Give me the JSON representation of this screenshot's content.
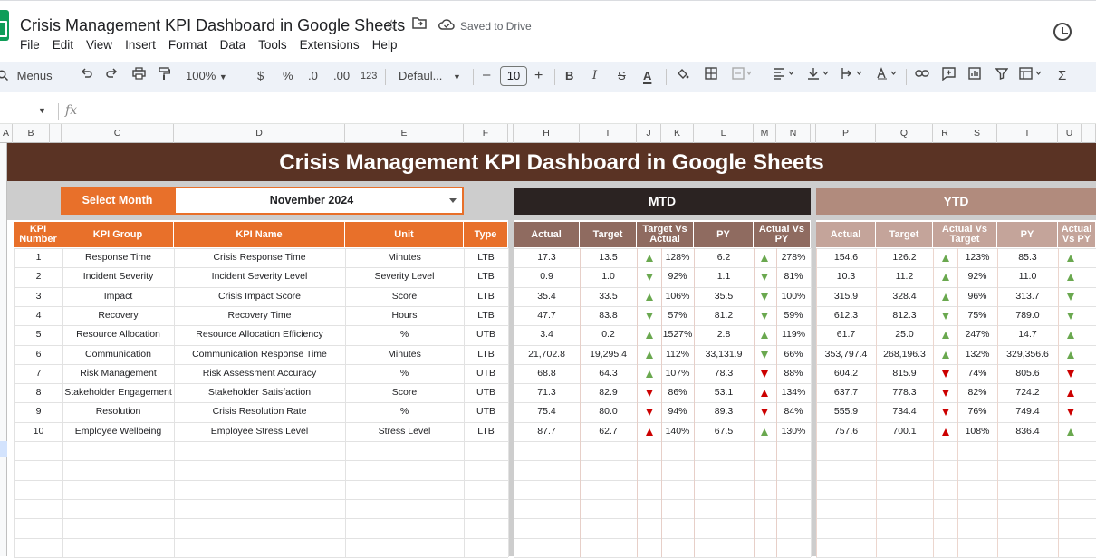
{
  "app": {
    "doc_title": "Crisis Management KPI Dashboard in Google Sheets",
    "saved_status": "Saved to Drive",
    "menu": [
      "File",
      "Edit",
      "View",
      "Insert",
      "Format",
      "Data",
      "Tools",
      "Extensions",
      "Help"
    ]
  },
  "toolbar": {
    "menus_label": "Menus",
    "zoom": "100%",
    "currency": "$",
    "percent": "%",
    "dec_decrease": ".0",
    "dec_increase": ".00",
    "number_format": "123",
    "font": "Defaul...",
    "minus": "–",
    "font_size": "10",
    "plus": "+",
    "bold": "B",
    "italic": "I",
    "strike": "S",
    "text_color": "A",
    "sigma": "Σ"
  },
  "formula_bar": {
    "fx": "fx"
  },
  "columns": [
    "A",
    "B",
    "C",
    "D",
    "E",
    "F",
    "H",
    "I",
    "J",
    "K",
    "L",
    "M",
    "N",
    "P",
    "Q",
    "R",
    "S",
    "T",
    "U"
  ],
  "dashboard": {
    "title": "Crisis Management KPI Dashboard in Google Sheets",
    "select_month_label": "Select Month",
    "selected_month": "November 2024",
    "mtd_label": "MTD",
    "ytd_label": "YTD",
    "headers_left": [
      "KPI Number",
      "KPI Group",
      "KPI Name",
      "Unit",
      "Type"
    ],
    "headers_mtd": [
      "Actual",
      "Target",
      "Target Vs Actual",
      "PY",
      "Actual Vs PY"
    ],
    "headers_ytd": [
      "Actual",
      "Target",
      "Actual Vs Target",
      "PY",
      "Actual Vs PY"
    ]
  },
  "colors": {
    "banner": "#5a3324",
    "orange": "#e8702a",
    "mtd_dark": "#2b2322",
    "ytd_light": "#b18b7d",
    "up_green": "#6aa84f",
    "down_red": "#cc0000"
  },
  "rows": [
    {
      "num": "1",
      "group": "Response Time",
      "name": "Crisis Response Time",
      "unit": "Minutes",
      "type": "LTB",
      "mtd": {
        "actual": "17.3",
        "target": "13.5",
        "tva": "128%",
        "tva_dir": "up",
        "py": "6.2",
        "avp": "278%",
        "avp_dir": "up"
      },
      "ytd": {
        "actual": "154.6",
        "target": "126.2",
        "avt": "123%",
        "avt_dir": "up",
        "py": "85.3",
        "avp_dir": "up"
      }
    },
    {
      "num": "2",
      "group": "Incident Severity",
      "name": "Incident Severity Level",
      "unit": "Severity Level",
      "type": "LTB",
      "mtd": {
        "actual": "0.9",
        "target": "1.0",
        "tva": "92%",
        "tva_dir": "down",
        "py": "1.1",
        "avp": "81%",
        "avp_dir": "down"
      },
      "ytd": {
        "actual": "10.3",
        "target": "11.2",
        "avt": "92%",
        "avt_dir": "up",
        "py": "11.0",
        "avp_dir": "up"
      }
    },
    {
      "num": "3",
      "group": "Impact",
      "name": "Crisis Impact Score",
      "unit": "Score",
      "type": "LTB",
      "mtd": {
        "actual": "35.4",
        "target": "33.5",
        "tva": "106%",
        "tva_dir": "up",
        "py": "35.5",
        "avp": "100%",
        "avp_dir": "down"
      },
      "ytd": {
        "actual": "315.9",
        "target": "328.4",
        "avt": "96%",
        "avt_dir": "up",
        "py": "313.7",
        "avp_dir": "down"
      }
    },
    {
      "num": "4",
      "group": "Recovery",
      "name": "Recovery Time",
      "unit": "Hours",
      "type": "LTB",
      "mtd": {
        "actual": "47.7",
        "target": "83.8",
        "tva": "57%",
        "tva_dir": "down",
        "py": "81.2",
        "avp": "59%",
        "avp_dir": "down"
      },
      "ytd": {
        "actual": "612.3",
        "target": "812.3",
        "avt": "75%",
        "avt_dir": "down",
        "py": "789.0",
        "avp_dir": "down"
      }
    },
    {
      "num": "5",
      "group": "Resource Allocation",
      "name": "Resource Allocation Efficiency",
      "unit": "%",
      "type": "UTB",
      "mtd": {
        "actual": "3.4",
        "target": "0.2",
        "tva": "1527%",
        "tva_dir": "up",
        "py": "2.8",
        "avp": "119%",
        "avp_dir": "up"
      },
      "ytd": {
        "actual": "61.7",
        "target": "25.0",
        "avt": "247%",
        "avt_dir": "up",
        "py": "14.7",
        "avp_dir": "up"
      }
    },
    {
      "num": "6",
      "group": "Communication",
      "name": "Communication Response Time",
      "unit": "Minutes",
      "type": "LTB",
      "mtd": {
        "actual": "21,702.8",
        "target": "19,295.4",
        "tva": "112%",
        "tva_dir": "up",
        "py": "33,131.9",
        "avp": "66%",
        "avp_dir": "down"
      },
      "ytd": {
        "actual": "353,797.4",
        "target": "268,196.3",
        "avt": "132%",
        "avt_dir": "up",
        "py": "329,356.6",
        "avp_dir": "up"
      }
    },
    {
      "num": "7",
      "group": "Risk Management",
      "name": "Risk Assessment Accuracy",
      "unit": "%",
      "type": "UTB",
      "mtd": {
        "actual": "68.8",
        "target": "64.3",
        "tva": "107%",
        "tva_dir": "up",
        "py": "78.3",
        "avp": "88%",
        "avp_dir": "down-red"
      },
      "ytd": {
        "actual": "604.2",
        "target": "815.9",
        "avt": "74%",
        "avt_dir": "down-red",
        "py": "805.6",
        "avp_dir": "down-red"
      }
    },
    {
      "num": "8",
      "group": "Stakeholder Engagement",
      "name": "Stakeholder Satisfaction",
      "unit": "Score",
      "type": "UTB",
      "mtd": {
        "actual": "71.3",
        "target": "82.9",
        "tva": "86%",
        "tva_dir": "down-red",
        "py": "53.1",
        "avp": "134%",
        "avp_dir": "up-red"
      },
      "ytd": {
        "actual": "637.7",
        "target": "778.3",
        "avt": "82%",
        "avt_dir": "down-red",
        "py": "724.2",
        "avp_dir": "up-red"
      }
    },
    {
      "num": "9",
      "group": "Resolution",
      "name": "Crisis Resolution Rate",
      "unit": "%",
      "type": "UTB",
      "mtd": {
        "actual": "75.4",
        "target": "80.0",
        "tva": "94%",
        "tva_dir": "down-red",
        "py": "89.3",
        "avp": "84%",
        "avp_dir": "down-red"
      },
      "ytd": {
        "actual": "555.9",
        "target": "734.4",
        "avt": "76%",
        "avt_dir": "down-red",
        "py": "749.4",
        "avp_dir": "down-red"
      }
    },
    {
      "num": "10",
      "group": "Employee Wellbeing",
      "name": "Employee Stress Level",
      "unit": "Stress Level",
      "type": "LTB",
      "mtd": {
        "actual": "87.7",
        "target": "62.7",
        "tva": "140%",
        "tva_dir": "up-red",
        "py": "67.5",
        "avp": "130%",
        "avp_dir": "up"
      },
      "ytd": {
        "actual": "757.6",
        "target": "700.1",
        "avt": "108%",
        "avt_dir": "up-red",
        "py": "836.4",
        "avp_dir": "up"
      }
    }
  ]
}
